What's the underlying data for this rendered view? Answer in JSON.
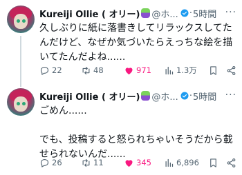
{
  "tweets": [
    {
      "name": "Kureiji Ollie ( オリー)",
      "handle": "@ホ...",
      "dot": "·",
      "time": "5時間",
      "text": "久しぶりに紙に落書きしてリラックスしてたんだけど、なぜか気づいたらえっちな絵を描いてたんだよね......",
      "replies": "22",
      "retweets": "48",
      "likes": "971",
      "views": "1.3万"
    },
    {
      "name": "Kureiji Ollie ( オリー)",
      "handle": "@ホ...",
      "dot": "·",
      "time": "5時間",
      "text": "ごめん......\n\nでも、投稿すると怒られちゃいそうだから載せられないんだ......",
      "replies": "26",
      "retweets": "11",
      "likes": "345",
      "views": "6,896"
    }
  ],
  "more_label": "···",
  "colors": {
    "like": "#f91880",
    "verified": "#1d9bf0",
    "muted": "#536471"
  }
}
